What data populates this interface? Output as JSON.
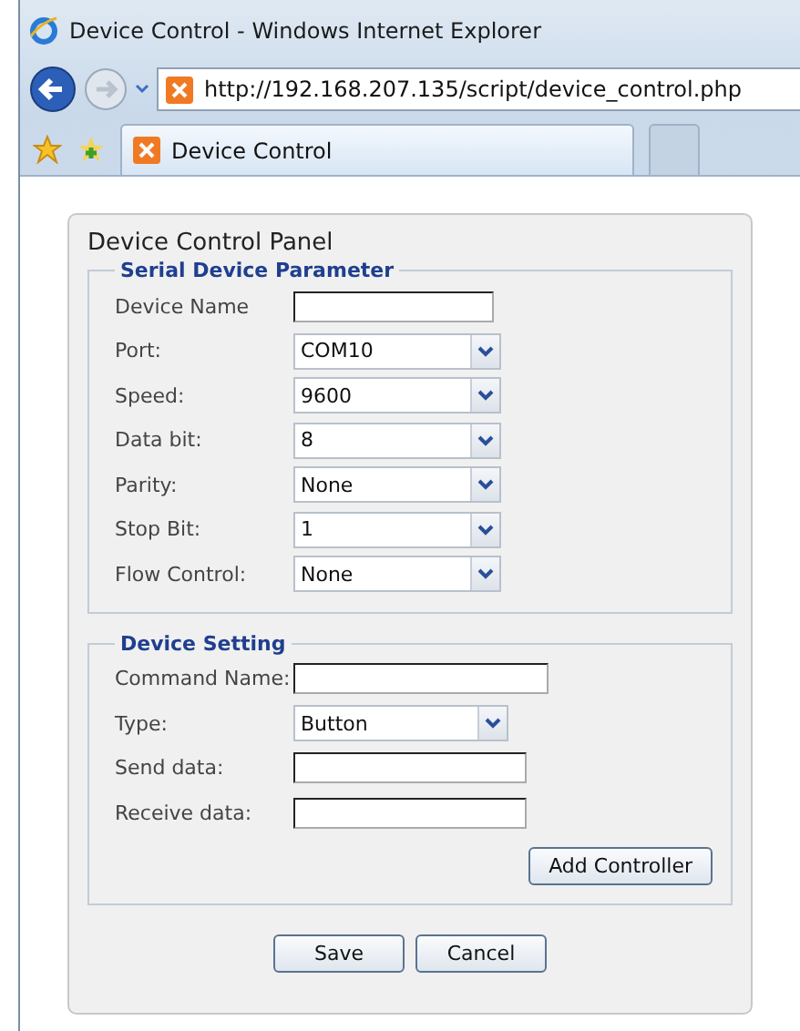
{
  "window": {
    "title": "Device Control - Windows Internet Explorer"
  },
  "address_bar": {
    "value": "http://192.168.207.135/script/device_control.php"
  },
  "tabs": [
    {
      "label": "Device Control",
      "selected": true
    }
  ],
  "panel": {
    "title": "Device Control Panel",
    "sections": [
      {
        "legend": "Serial Device Parameter",
        "fields": [
          {
            "label": "Device Name",
            "kind": "text"
          },
          {
            "label": "Port:",
            "kind": "select",
            "value": "COM10"
          },
          {
            "label": "Speed:",
            "kind": "select",
            "value": "9600"
          },
          {
            "label": "Data bit:",
            "kind": "select",
            "value": "8"
          },
          {
            "label": "Parity:",
            "kind": "select",
            "value": "None"
          },
          {
            "label": "Stop Bit:",
            "kind": "select",
            "value": "1"
          },
          {
            "label": "Flow Control:",
            "kind": "select",
            "value": "None"
          }
        ]
      },
      {
        "legend": "Device Setting",
        "fields": [
          {
            "label": "Command Name:",
            "kind": "text"
          },
          {
            "label": "Type:",
            "kind": "select",
            "value": "Button"
          },
          {
            "label": "Send data:",
            "kind": "text"
          },
          {
            "label": "Receive data:",
            "kind": "text"
          }
        ],
        "button": "Add Controller"
      }
    ],
    "buttons": [
      "Save",
      "Cancel"
    ]
  }
}
